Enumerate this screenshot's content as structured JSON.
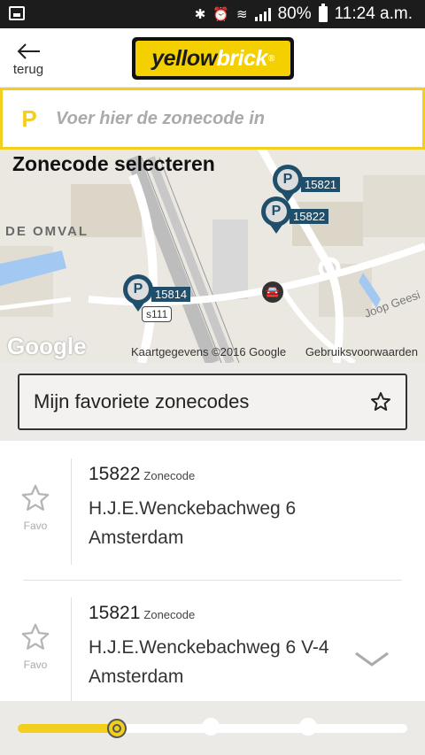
{
  "status_bar": {
    "battery": "80%",
    "time": "11:24 a.m."
  },
  "header": {
    "back_label": "terug",
    "logo_word1": "yellow",
    "logo_word2": "brick",
    "logo_mark": "®"
  },
  "zone_input": {
    "icon_text": "P",
    "placeholder": "Voer hier de zonecode in",
    "value": ""
  },
  "map": {
    "title": "Zonecode selecteren",
    "area_label": "DE OMVAL",
    "street_label": "Joop Geesi",
    "road_label": "s111",
    "pins": [
      {
        "label": "15821"
      },
      {
        "label": "15822"
      },
      {
        "label": "15814"
      }
    ],
    "google": "Google",
    "attribution": "Kaartgegevens ©2016 Google",
    "terms": "Gebruiksvoorwaarden"
  },
  "favorites": {
    "label": "Mijn favoriete zonecodes"
  },
  "zones": [
    {
      "code": "15822",
      "code_label": "Zonecode",
      "street": "H.J.E.Wenckebachweg 6",
      "city": "Amsterdam",
      "favo_label": "Favo"
    },
    {
      "code": "15821",
      "code_label": "Zonecode",
      "street": "H.J.E.Wenckebachweg 6 V-4",
      "city": "Amsterdam",
      "favo_label": "Favo"
    }
  ],
  "stepper": {
    "total_steps": 4,
    "current_step": 1,
    "progress": 0.25
  },
  "colors": {
    "brand_yellow": "#f2cf1c",
    "pin_blue": "#1f4f6b",
    "status_bar": "#1c1c1c"
  }
}
